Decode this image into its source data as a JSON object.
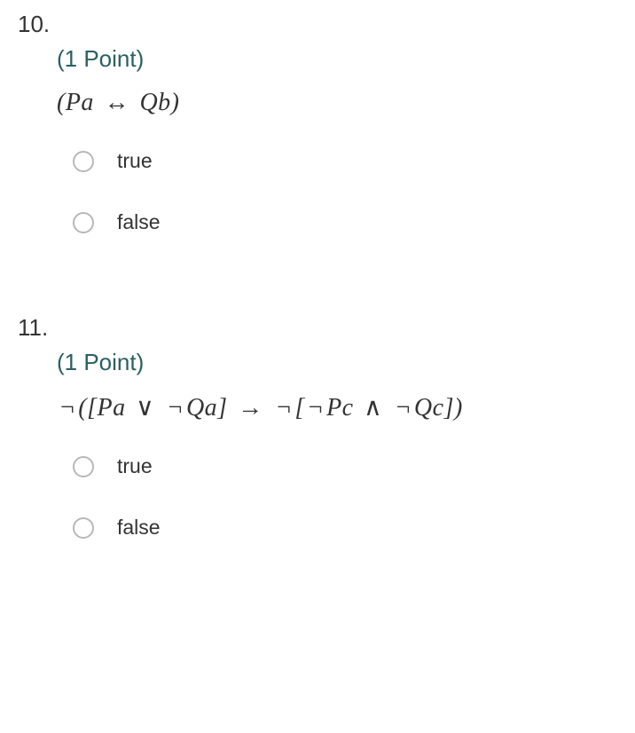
{
  "questions": [
    {
      "number": "10.",
      "points": "(1 Point)",
      "formula_parts": {
        "open": "(",
        "pa": "Pa",
        "biconditional": " ↔ ",
        "qb": "Qb",
        "close": ")"
      },
      "options": [
        {
          "label": "true"
        },
        {
          "label": "false"
        }
      ]
    },
    {
      "number": "11.",
      "points": "(1 Point)",
      "formula_parts": {
        "neg1": "¬",
        "open1": "(",
        "lb1": "[",
        "pa": "Pa",
        "or": " ∨ ",
        "neg2": "¬",
        "qa": "Qa",
        "rb1": "]",
        "implies": "  →  ",
        "neg3": "¬",
        "lb2": "[",
        "neg4": "¬",
        "pc": "Pc",
        "and": " ∧ ",
        "neg5": "¬",
        "qc": "Qc",
        "rb2": "]",
        "close1": ")"
      },
      "options": [
        {
          "label": "true"
        },
        {
          "label": "false"
        }
      ]
    }
  ]
}
